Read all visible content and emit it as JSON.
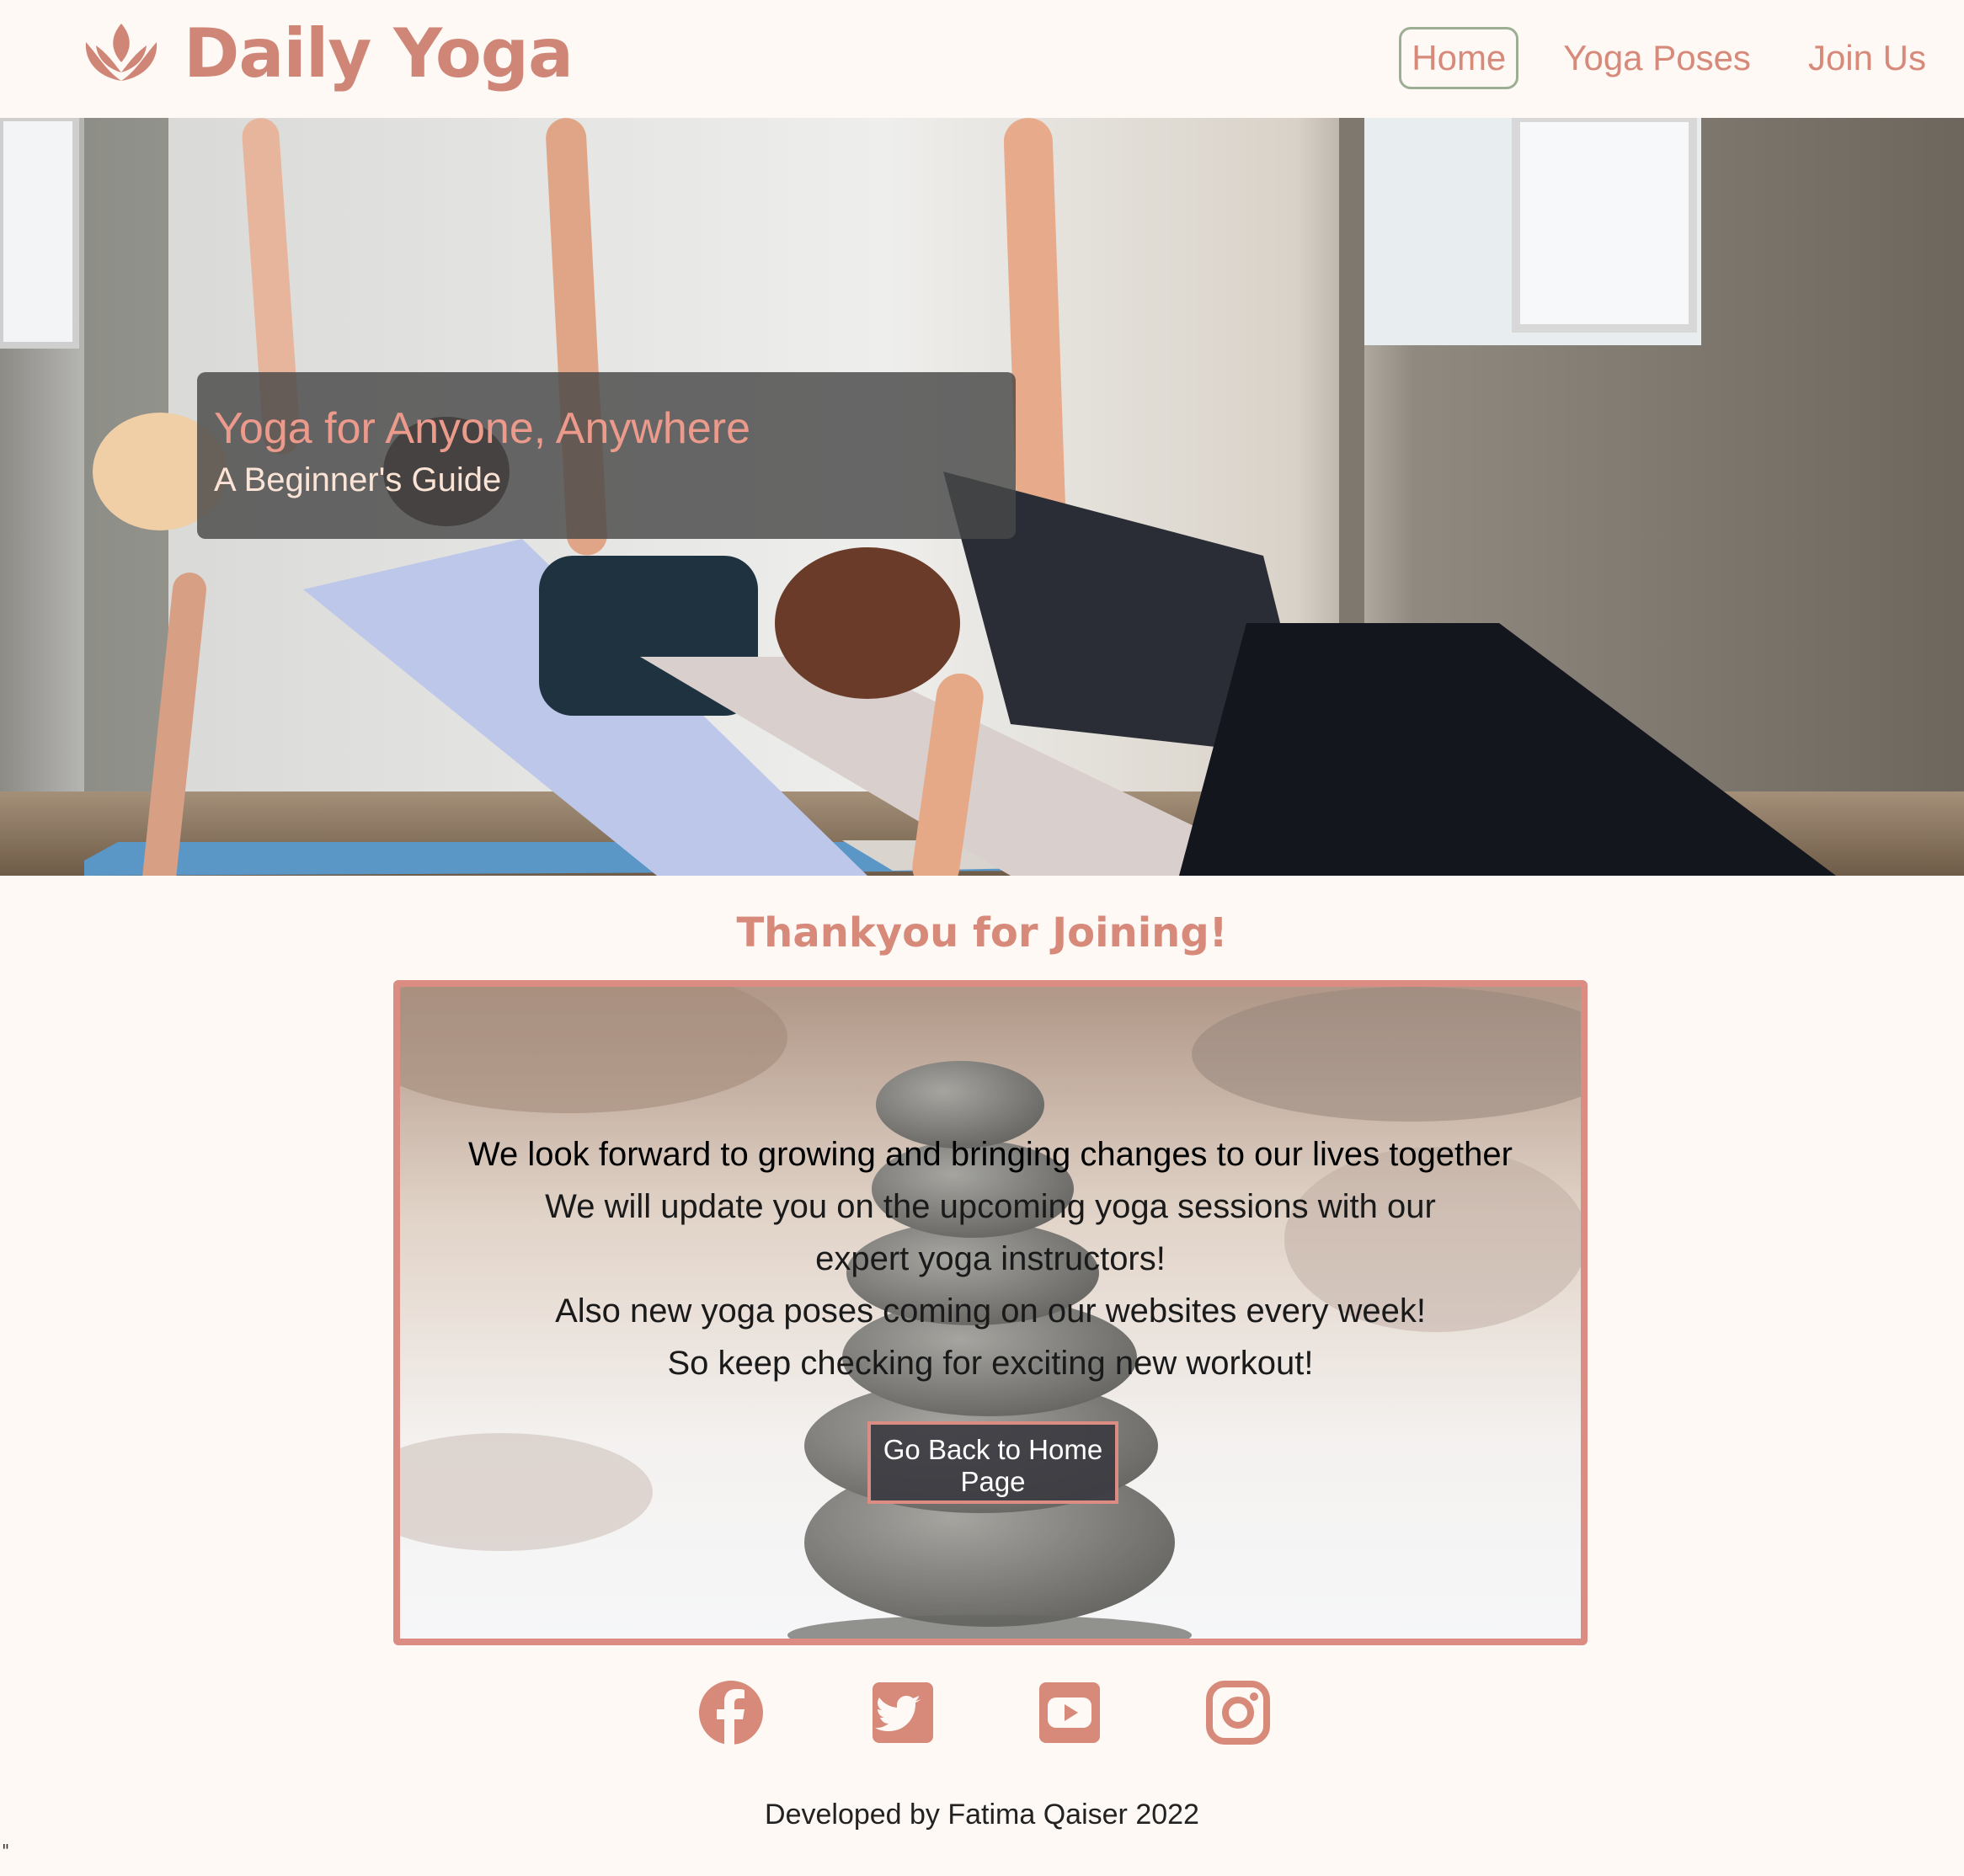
{
  "header": {
    "brand_name": "Daily Yoga",
    "brand_icon": "lotus-icon",
    "nav": [
      {
        "label": "Home",
        "active": true
      },
      {
        "label": "Yoga Poses",
        "active": false
      },
      {
        "label": "Join Us",
        "active": false
      }
    ]
  },
  "hero": {
    "title": "Yoga for Anyone, Anywhere",
    "subtitle": "A Beginner's Guide"
  },
  "thanks": {
    "heading": "Thankyou for Joining!",
    "lead": "We look forward to growing and bringing changes to our lives together",
    "lines": [
      "We will update you on the upcoming yoga sessions with our",
      "expert yoga instructors!",
      "Also new yoga poses coming on our websites every week!",
      "So keep checking for exciting new workout!"
    ],
    "button_label": "Go Back to Home Page"
  },
  "social": [
    {
      "icon": "facebook-icon"
    },
    {
      "icon": "twitter-icon"
    },
    {
      "icon": "youtube-icon"
    },
    {
      "icon": "instagram-icon"
    }
  ],
  "footer": {
    "credit": "Developed by Fatima Qaiser 2022",
    "stray_text": "\""
  },
  "colors": {
    "accent": "#d7897a",
    "background": "#fef9f5",
    "active_nav_border": "#9cae94",
    "card_border": "#dc8d83"
  }
}
